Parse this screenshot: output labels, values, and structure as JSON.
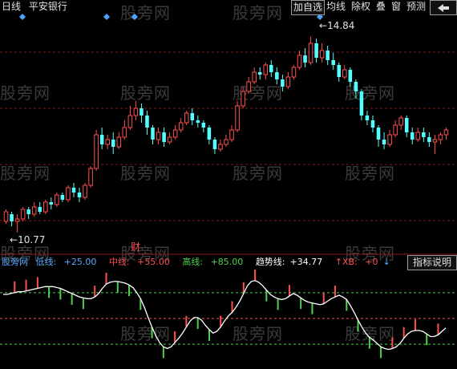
{
  "stock_name": "平安银行",
  "period_label": "日线",
  "toolbar": {
    "add_watchlist": "加自选",
    "ma_lines": "均线",
    "adjust": "除权",
    "overlay": "叠",
    "window": "窗",
    "forecast": "预测",
    "back_icon": "back-arrow-icon"
  },
  "price_annotations": {
    "high": "14.84",
    "low": "10.77"
  },
  "event_marker": "财",
  "indicator": {
    "source": "股旁网",
    "low_label": "低线:",
    "low_value": "+25.00",
    "mid_label": "中线:",
    "mid_value": "+55.00",
    "high_label": "高线:",
    "high_value": "+85.00",
    "trend_label": "趋势线:",
    "trend_value": "+34.77",
    "xb_label": "XB:",
    "xb_value": "+0",
    "help_button": "指标说明"
  },
  "watermarks": [
    "股旁网",
    "股旁网",
    "股旁网",
    "股旁网",
    "股旁网",
    "股旁网",
    "股旁网",
    "股旁网",
    "股旁网",
    "股旁网",
    "股旁网",
    "股旁网",
    "股旁网",
    "股旁网"
  ],
  "colors": {
    "up": "#ff5050",
    "down": "#54ffff",
    "trend_line": "#ffffff",
    "low_line": "#5aa8ff",
    "mid_line": "#ff5050",
    "high_line": "#50d050",
    "trend_text": "#ffffff",
    "xb_text": "#ff5050",
    "marker": "#4aa3ff"
  },
  "chart_data": [
    {
      "type": "candlestick",
      "title": "平安银行",
      "ylim": [
        10.5,
        15.3
      ],
      "highlighted_points": {
        "max": 14.84,
        "min": 10.77
      },
      "candles": [
        [
          11.0,
          11.2,
          11.25,
          10.95
        ],
        [
          11.15,
          11.0,
          11.2,
          10.9
        ],
        [
          11.0,
          11.05,
          11.15,
          10.77
        ],
        [
          11.05,
          11.25,
          11.3,
          11.0
        ],
        [
          11.25,
          11.15,
          11.3,
          11.05
        ],
        [
          11.15,
          11.3,
          11.4,
          11.1
        ],
        [
          11.3,
          11.2,
          11.4,
          11.15
        ],
        [
          11.2,
          11.4,
          11.45,
          11.15
        ],
        [
          11.4,
          11.35,
          11.5,
          11.25
        ],
        [
          11.35,
          11.55,
          11.6,
          11.3
        ],
        [
          11.55,
          11.45,
          11.6,
          11.4
        ],
        [
          11.45,
          11.7,
          11.75,
          11.4
        ],
        [
          11.7,
          11.6,
          11.8,
          11.5
        ],
        [
          11.6,
          11.5,
          11.7,
          11.4
        ],
        [
          11.5,
          11.75,
          11.8,
          11.45
        ],
        [
          11.75,
          12.1,
          12.15,
          11.7
        ],
        [
          12.1,
          12.8,
          12.9,
          12.05
        ],
        [
          12.8,
          12.6,
          12.95,
          12.5
        ],
        [
          12.6,
          12.7,
          12.8,
          12.5
        ],
        [
          12.7,
          12.55,
          12.85,
          12.4
        ],
        [
          12.55,
          12.75,
          12.85,
          12.5
        ],
        [
          12.75,
          12.95,
          13.1,
          12.7
        ],
        [
          12.95,
          13.2,
          13.4,
          12.9
        ],
        [
          13.2,
          13.35,
          13.5,
          13.1
        ],
        [
          13.35,
          13.2,
          13.45,
          13.05
        ],
        [
          13.2,
          12.95,
          13.3,
          12.8
        ],
        [
          12.95,
          12.7,
          13.0,
          12.6
        ],
        [
          12.7,
          12.85,
          12.95,
          12.6
        ],
        [
          12.85,
          12.65,
          12.95,
          12.55
        ],
        [
          12.65,
          12.75,
          12.85,
          12.6
        ],
        [
          12.75,
          12.9,
          13.0,
          12.7
        ],
        [
          12.9,
          13.05,
          13.15,
          12.85
        ],
        [
          13.05,
          13.25,
          13.3,
          13.0
        ],
        [
          13.25,
          13.1,
          13.35,
          13.0
        ],
        [
          13.1,
          13.05,
          13.2,
          12.95
        ],
        [
          13.05,
          12.95,
          13.1,
          12.85
        ],
        [
          12.95,
          12.7,
          13.0,
          12.6
        ],
        [
          12.7,
          12.5,
          12.75,
          12.4
        ],
        [
          12.5,
          12.6,
          12.7,
          12.45
        ],
        [
          12.6,
          12.7,
          12.8,
          12.55
        ],
        [
          12.7,
          12.9,
          13.0,
          12.65
        ],
        [
          12.9,
          13.4,
          13.5,
          12.85
        ],
        [
          13.4,
          13.7,
          13.8,
          13.35
        ],
        [
          13.7,
          13.9,
          14.0,
          13.65
        ],
        [
          13.9,
          14.1,
          14.2,
          13.85
        ],
        [
          14.1,
          14.05,
          14.2,
          13.95
        ],
        [
          14.05,
          14.25,
          14.3,
          13.95
        ],
        [
          14.25,
          14.1,
          14.35,
          14.0
        ],
        [
          14.1,
          13.95,
          14.2,
          13.85
        ],
        [
          13.95,
          13.8,
          14.05,
          13.7
        ],
        [
          13.8,
          14.0,
          14.1,
          13.75
        ],
        [
          14.0,
          14.2,
          14.25,
          13.95
        ],
        [
          14.2,
          14.45,
          14.55,
          14.15
        ],
        [
          14.45,
          14.3,
          14.6,
          14.2
        ],
        [
          14.3,
          14.7,
          14.84,
          14.25
        ],
        [
          14.7,
          14.4,
          14.8,
          14.3
        ],
        [
          14.4,
          14.55,
          14.7,
          14.3
        ],
        [
          14.55,
          14.35,
          14.65,
          14.25
        ],
        [
          14.35,
          14.25,
          14.5,
          14.15
        ],
        [
          14.25,
          14.0,
          14.3,
          13.9
        ],
        [
          14.0,
          14.15,
          14.25,
          13.95
        ],
        [
          14.15,
          13.9,
          14.2,
          13.8
        ],
        [
          13.9,
          13.7,
          13.95,
          13.55
        ],
        [
          13.7,
          13.2,
          13.75,
          13.1
        ],
        [
          13.2,
          13.1,
          13.3,
          13.0
        ],
        [
          13.1,
          12.95,
          13.2,
          12.85
        ],
        [
          12.95,
          12.7,
          13.0,
          12.55
        ],
        [
          12.7,
          12.6,
          12.85,
          12.5
        ],
        [
          12.6,
          12.8,
          12.9,
          12.55
        ],
        [
          12.8,
          13.0,
          13.1,
          12.75
        ],
        [
          13.0,
          13.15,
          13.2,
          12.9
        ],
        [
          13.15,
          12.85,
          13.2,
          12.75
        ],
        [
          12.85,
          12.7,
          12.95,
          12.6
        ],
        [
          12.7,
          12.85,
          12.95,
          12.65
        ],
        [
          12.85,
          12.75,
          12.95,
          12.65
        ],
        [
          12.75,
          12.65,
          12.85,
          12.55
        ],
        [
          12.65,
          12.7,
          12.8,
          12.4
        ],
        [
          12.7,
          12.8,
          12.85,
          12.6
        ],
        [
          12.8,
          12.9,
          12.95,
          12.7
        ]
      ]
    },
    {
      "type": "line",
      "title": "",
      "ylim": [
        0,
        110
      ],
      "reference_lines": [
        25,
        55,
        85
      ],
      "series": [
        {
          "name": "趋势线",
          "values": [
            83,
            83,
            84,
            85,
            86,
            86,
            87,
            88,
            89,
            90,
            91,
            92,
            92,
            92,
            91,
            90,
            88,
            86,
            84,
            82,
            80,
            79,
            78,
            78,
            80,
            84,
            90,
            95,
            97,
            98,
            98,
            97,
            96,
            94,
            91,
            85,
            78,
            68,
            56,
            45,
            35,
            27,
            22,
            20,
            22,
            27,
            32,
            38,
            45,
            52,
            56,
            56,
            53,
            47,
            42,
            38,
            40,
            45,
            52,
            58,
            62,
            68,
            75,
            84,
            93,
            98,
            99,
            97,
            93,
            88,
            83,
            80,
            78,
            77,
            78,
            81,
            84,
            82,
            79,
            76,
            74,
            73,
            72,
            71,
            72,
            75,
            78,
            80,
            82,
            80,
            77,
            70,
            62,
            53,
            45,
            38,
            33,
            30,
            26,
            22,
            20,
            19,
            20,
            22,
            26,
            32,
            37,
            40,
            41,
            41,
            40,
            37,
            34,
            34,
            36,
            40,
            44
          ]
        }
      ],
      "markers": [
        {
          "value": 34.77,
          "label": "趋势线"
        }
      ]
    }
  ]
}
